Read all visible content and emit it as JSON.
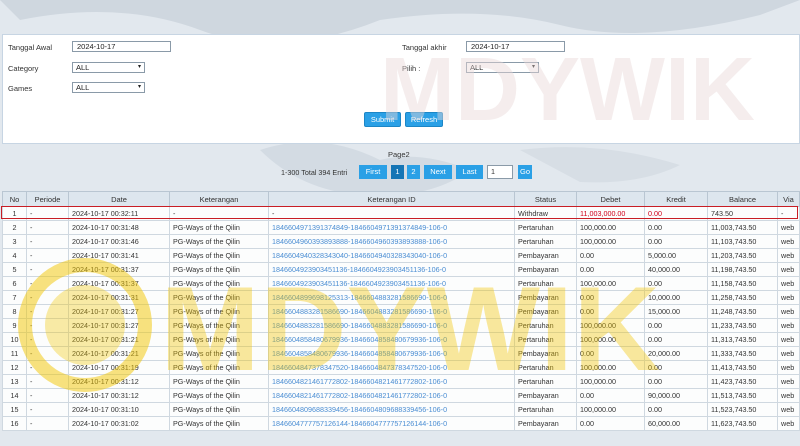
{
  "filters": {
    "start_label": "Tanggal Awal",
    "start_value": "2024-10-17",
    "end_label": "Tanggal akhir",
    "end_value": "2024-10-17",
    "category_label": "Category",
    "category_value": "ALL",
    "pilih_label": "Pilih :",
    "pilih_value": "ALL",
    "games_label": "Games",
    "games_value": "ALL",
    "submit_label": "Submit",
    "refresh_label": "Refresh"
  },
  "pager": {
    "page_title": "Page2",
    "range_text": "1-300 Total 394 Entri",
    "first": "First",
    "p1": "1",
    "p2": "2",
    "next": "Next",
    "last": "Last",
    "page_input": "1",
    "go": "Go"
  },
  "table": {
    "headers": [
      "No",
      "Periode",
      "Date",
      "Keterangan",
      "Keterangan ID",
      "Status",
      "Debet",
      "Kredit",
      "Balance",
      "Via"
    ],
    "rows": [
      [
        "1",
        "-",
        "2024-10-17 00:32:11",
        "-",
        "-",
        "Withdraw",
        "11,003,000.00",
        "0.00",
        "743.50",
        "-"
      ],
      [
        "2",
        "-",
        "2024-10-17 00:31:48",
        "PG-Ways of the Qilin",
        "1846604971391374849-1846604971391374849-106-0",
        "Pertaruhan",
        "100,000.00",
        "0.00",
        "11,003,743.50",
        "web"
      ],
      [
        "3",
        "-",
        "2024-10-17 00:31:46",
        "PG-Ways of the Qilin",
        "1846604960393893888-1846604960393893888-106-0",
        "Pertaruhan",
        "100,000.00",
        "0.00",
        "11,103,743.50",
        "web"
      ],
      [
        "4",
        "-",
        "2024-10-17 00:31:41",
        "PG-Ways of the Qilin",
        "1846604940328343040-1846604940328343040-106-0",
        "Pembayaran",
        "0.00",
        "5,000.00",
        "11,203,743.50",
        "web"
      ],
      [
        "5",
        "-",
        "2024-10-17 00:31:37",
        "PG-Ways of the Qilin",
        "1846604923903451136-1846604923903451136-106-0",
        "Pembayaran",
        "0.00",
        "40,000.00",
        "11,198,743.50",
        "web"
      ],
      [
        "6",
        "-",
        "2024-10-17 00:31:37",
        "PG-Ways of the Qilin",
        "1846604923903451136-1846604923903451136-106-0",
        "Pertaruhan",
        "100,000.00",
        "0.00",
        "11,158,743.50",
        "web"
      ],
      [
        "7",
        "-",
        "2024-10-17 00:31:31",
        "PG-Ways of the Qilin",
        "1846604899698125313-1846604883281586690-106-0",
        "Pembayaran",
        "0.00",
        "10,000.00",
        "11,258,743.50",
        "web"
      ],
      [
        "8",
        "-",
        "2024-10-17 00:31:27",
        "PG-Ways of the Qilin",
        "1846604883281586690-1846604883281586690-106-0",
        "Pembayaran",
        "0.00",
        "15,000.00",
        "11,248,743.50",
        "web"
      ],
      [
        "9",
        "-",
        "2024-10-17 00:31:27",
        "PG-Ways of the Qilin",
        "1846604883281586690-1846604883281586690-106-0",
        "Pertaruhan",
        "100,000.00",
        "0.00",
        "11,233,743.50",
        "web"
      ],
      [
        "10",
        "-",
        "2024-10-17 00:31:21",
        "PG-Ways of the Qilin",
        "1846604858480679936-1846604858480679936-106-0",
        "Pertaruhan",
        "100,000.00",
        "0.00",
        "11,313,743.50",
        "web"
      ],
      [
        "11",
        "-",
        "2024-10-17 00:31:21",
        "PG-Ways of the Qilin",
        "1846604858480679936-1846604858480679936-106-0",
        "Pembayaran",
        "0.00",
        "20,000.00",
        "11,333,743.50",
        "web"
      ],
      [
        "12",
        "-",
        "2024-10-17 00:31:19",
        "PG-Ways of the Qilin",
        "1846604847378347520-1846604847378347520-106-0",
        "Pertaruhan",
        "100,000.00",
        "0.00",
        "11,413,743.50",
        "web"
      ],
      [
        "13",
        "-",
        "2024-10-17 00:31:12",
        "PG-Ways of the Qilin",
        "1846604821461772802-1846604821461772802-106-0",
        "Pertaruhan",
        "100,000.00",
        "0.00",
        "11,423,743.50",
        "web"
      ],
      [
        "14",
        "-",
        "2024-10-17 00:31:12",
        "PG-Ways of the Qilin",
        "1846604821461772802-1846604821461772802-106-0",
        "Pembayaran",
        "0.00",
        "90,000.00",
        "11,513,743.50",
        "web"
      ],
      [
        "15",
        "-",
        "2024-10-17 00:31:10",
        "PG-Ways of the Qilin",
        "1846604809688339456-1846604809688339456-106-0",
        "Pertaruhan",
        "100,000.00",
        "0.00",
        "11,523,743.50",
        "web"
      ],
      [
        "16",
        "-",
        "2024-10-17 00:31:02",
        "PG-Ways of the Qilin",
        "1846604777757126144-1846604777757126144-106-0",
        "Pembayaran",
        "0.00",
        "60,000.00",
        "11,623,743.50",
        "web"
      ]
    ]
  },
  "colors": {
    "accent": "#2aa0e6",
    "highlight": "#c81d25",
    "watermark": "#f2c500"
  },
  "watermark_text": "MDYWIK"
}
